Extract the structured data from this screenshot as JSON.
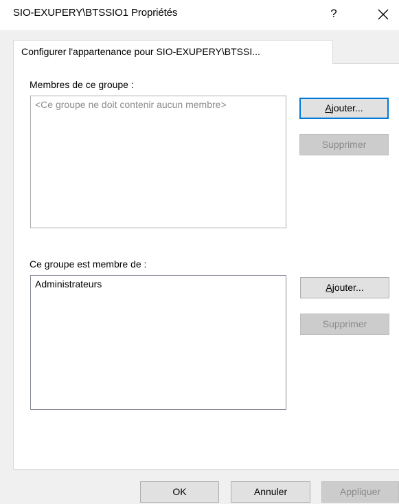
{
  "window": {
    "title": "SIO-EXUPERY\\BTSSIO1 Propriétés",
    "help_label": "?"
  },
  "tab": {
    "label": "Configurer l'appartenance pour SIO-EXUPERY\\BTSSI..."
  },
  "members": {
    "label": "Membres de ce groupe :",
    "items": [
      "<Ce groupe ne doit contenir aucun membre>"
    ],
    "add_prefix": "A",
    "add_rest": "jouter...",
    "remove_label": "Supprimer"
  },
  "member_of": {
    "label": "Ce groupe est membre de :",
    "items": [
      "Administrateurs"
    ],
    "add_prefix": "A",
    "add_rest": "jouter...",
    "remove_label": "Supprimer"
  },
  "footer": {
    "ok_label": "OK",
    "cancel_label": "Annuler",
    "apply_label": "Appliquer"
  },
  "colors": {
    "focus_accent": "#0078d7",
    "disabled_text": "#8a8a8a",
    "placeholder_text": "#8c8c8c"
  }
}
